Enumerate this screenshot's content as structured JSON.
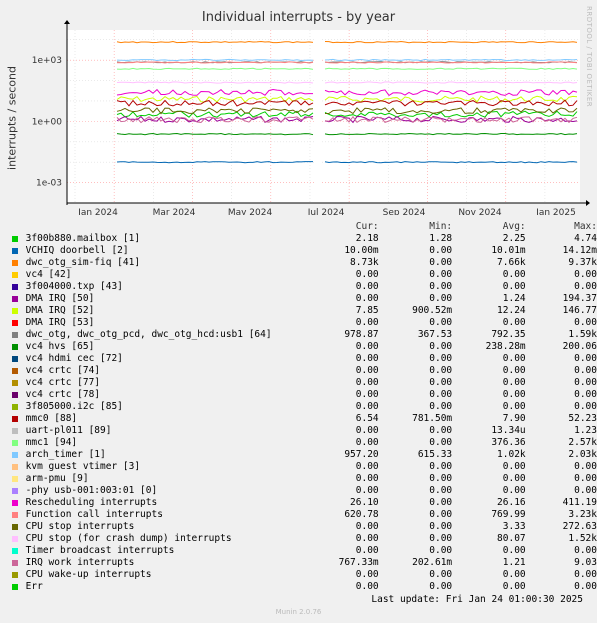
{
  "chart_data": {
    "type": "line",
    "title": "Individual interrupts - by year",
    "ylabel": "interrupts / second",
    "yscale": "log",
    "ylim": [
      0.0001,
      30000
    ],
    "y_ticks": [
      {
        "value": 0.001,
        "label": "1e-03"
      },
      {
        "value": 1,
        "label": "1e+00"
      },
      {
        "value": 1000,
        "label": "1e+03"
      }
    ],
    "x_ticks": [
      "Jan 2024",
      "Mar 2024",
      "May 2024",
      "Jul 2024",
      "Sep 2024",
      "Nov 2024",
      "Jan 2025"
    ],
    "grid": true,
    "columns": [
      "Cur:",
      "Min:",
      "Avg:",
      "Max:"
    ],
    "series": [
      {
        "name": "3f00b880.mailbox [1]",
        "color": "#00cc00",
        "cur": "2.18",
        "min": "1.28",
        "avg": "2.25",
        "max": "4.74"
      },
      {
        "name": "VCHIQ doorbell [2]",
        "color": "#0066b3",
        "cur": "10.00m",
        "min": "0.00",
        "avg": "10.01m",
        "max": "14.12m"
      },
      {
        "name": "dwc_otg_sim-fiq [41]",
        "color": "#ff8000",
        "cur": "8.73k",
        "min": "0.00",
        "avg": "7.66k",
        "max": "9.37k"
      },
      {
        "name": "vc4 [42]",
        "color": "#ffcc00",
        "cur": "0.00",
        "min": "0.00",
        "avg": "0.00",
        "max": "0.00"
      },
      {
        "name": "3f004000.txp [43]",
        "color": "#330099",
        "cur": "0.00",
        "min": "0.00",
        "avg": "0.00",
        "max": "0.00"
      },
      {
        "name": "DMA IRQ [50]",
        "color": "#990099",
        "cur": "0.00",
        "min": "0.00",
        "avg": "1.24",
        "max": "194.37"
      },
      {
        "name": "DMA IRQ [52]",
        "color": "#ccff00",
        "cur": "7.85",
        "min": "900.52m",
        "avg": "12.24",
        "max": "146.77"
      },
      {
        "name": "DMA IRQ [53]",
        "color": "#ff0000",
        "cur": "0.00",
        "min": "0.00",
        "avg": "0.00",
        "max": "0.00"
      },
      {
        "name": "dwc_otg, dwc_otg_pcd, dwc_otg_hcd:usb1 [64]",
        "color": "#808080",
        "cur": "978.87",
        "min": "367.53",
        "avg": "792.35",
        "max": "1.59k"
      },
      {
        "name": "vc4 hvs [65]",
        "color": "#008f00",
        "cur": "0.00",
        "min": "0.00",
        "avg": "238.28m",
        "max": "200.06"
      },
      {
        "name": "vc4 hdmi cec [72]",
        "color": "#00487d",
        "cur": "0.00",
        "min": "0.00",
        "avg": "0.00",
        "max": "0.00"
      },
      {
        "name": "vc4 crtc [74]",
        "color": "#b35a00",
        "cur": "0.00",
        "min": "0.00",
        "avg": "0.00",
        "max": "0.00"
      },
      {
        "name": "vc4 crtc [77]",
        "color": "#b38f00",
        "cur": "0.00",
        "min": "0.00",
        "avg": "0.00",
        "max": "0.00"
      },
      {
        "name": "vc4 crtc [78]",
        "color": "#6b006b",
        "cur": "0.00",
        "min": "0.00",
        "avg": "0.00",
        "max": "0.00"
      },
      {
        "name": "3f805000.i2c [85]",
        "color": "#8fb300",
        "cur": "0.00",
        "min": "0.00",
        "avg": "0.00",
        "max": "0.00"
      },
      {
        "name": "mmc0 [88]",
        "color": "#b30000",
        "cur": "6.54",
        "min": "781.50m",
        "avg": "7.90",
        "max": "52.23"
      },
      {
        "name": "uart-pl011 [89]",
        "color": "#bebebe",
        "cur": "0.00",
        "min": "0.00",
        "avg": "13.34u",
        "max": "1.23"
      },
      {
        "name": "mmc1 [94]",
        "color": "#80ff80",
        "cur": "0.00",
        "min": "0.00",
        "avg": "376.36",
        "max": "2.57k"
      },
      {
        "name": "arch_timer [1]",
        "color": "#80c9ff",
        "cur": "957.20",
        "min": "615.33",
        "avg": "1.02k",
        "max": "2.03k"
      },
      {
        "name": "kvm guest vtimer [3]",
        "color": "#ffc080",
        "cur": "0.00",
        "min": "0.00",
        "avg": "0.00",
        "max": "0.00"
      },
      {
        "name": "arm-pmu [9]",
        "color": "#ffe680",
        "cur": "0.00",
        "min": "0.00",
        "avg": "0.00",
        "max": "0.00"
      },
      {
        "name": "-phy        usb-001:003:01 [0]",
        "color": "#aa80ff",
        "cur": "0.00",
        "min": "0.00",
        "avg": "0.00",
        "max": "0.00"
      },
      {
        "name": "Rescheduling interrupts",
        "color": "#ee00cc",
        "cur": "26.10",
        "min": "0.00",
        "avg": "26.16",
        "max": "411.19"
      },
      {
        "name": "Function call interrupts",
        "color": "#ff8080",
        "cur": "620.78",
        "min": "0.00",
        "avg": "769.99",
        "max": "3.23k"
      },
      {
        "name": "CPU stop interrupts",
        "color": "#666600",
        "cur": "0.00",
        "min": "0.00",
        "avg": "3.33",
        "max": "272.63"
      },
      {
        "name": "CPU stop (for crash dump) interrupts",
        "color": "#ffbfff",
        "cur": "0.00",
        "min": "0.00",
        "avg": "80.07",
        "max": "1.52k"
      },
      {
        "name": "Timer broadcast interrupts",
        "color": "#00ffcc",
        "cur": "0.00",
        "min": "0.00",
        "avg": "0.00",
        "max": "0.00"
      },
      {
        "name": "IRQ work interrupts",
        "color": "#cc6699",
        "cur": "767.33m",
        "min": "202.61m",
        "avg": "1.21",
        "max": "9.03"
      },
      {
        "name": "CPU wake-up interrupts",
        "color": "#999900",
        "cur": "0.00",
        "min": "0.00",
        "avg": "0.00",
        "max": "0.00"
      },
      {
        "name": "Err",
        "color": "#00cc00",
        "cur": "0.00",
        "min": "0.00",
        "avg": "0.00",
        "max": "0.00"
      }
    ]
  },
  "watermark": "RRDTOOL / TOBI OETIKER",
  "last_update": "Last update: Fri Jan 24 01:00:30 2025",
  "version": "Munin 2.0.76"
}
